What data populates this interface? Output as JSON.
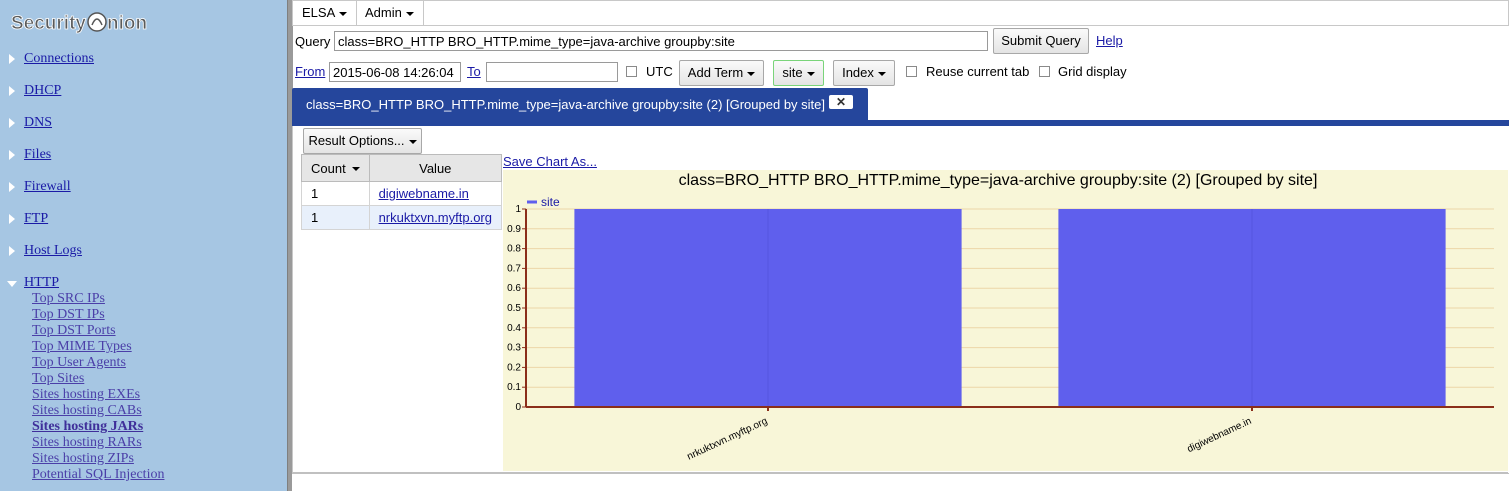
{
  "sidebar": {
    "logo_text": "SecurityOnion",
    "items": [
      {
        "label": "Connections"
      },
      {
        "label": "DHCP"
      },
      {
        "label": "DNS"
      },
      {
        "label": "Files"
      },
      {
        "label": "Firewall"
      },
      {
        "label": "FTP"
      },
      {
        "label": "Host Logs"
      },
      {
        "label": "HTTP"
      }
    ],
    "http_subitems": [
      {
        "label": "Top SRC IPs"
      },
      {
        "label": "Top DST IPs"
      },
      {
        "label": "Top DST Ports"
      },
      {
        "label": "Top MIME Types"
      },
      {
        "label": "Top User Agents"
      },
      {
        "label": "Top Sites"
      },
      {
        "label": "Sites hosting EXEs"
      },
      {
        "label": "Sites hosting CABs"
      },
      {
        "label": "Sites hosting JARs"
      },
      {
        "label": "Sites hosting RARs"
      },
      {
        "label": "Sites hosting ZIPs"
      },
      {
        "label": "Potential SQL Injection"
      }
    ]
  },
  "menubar": {
    "elsa": "ELSA",
    "admin": "Admin"
  },
  "query": {
    "label": "Query",
    "value": "class=BRO_HTTP BRO_HTTP.mime_type=java-archive groupby:site",
    "submit": "Submit Query",
    "help": "Help"
  },
  "options": {
    "from_label": "From",
    "from_value": "2015-06-08 14:26:04",
    "to_label": "To",
    "to_value": "",
    "utc_label": "UTC",
    "add_term": "Add Term",
    "groupby": "site",
    "index": "Index",
    "reuse_tab": "Reuse current tab",
    "grid_display": "Grid display"
  },
  "tab": {
    "label": "class=BRO_HTTP BRO_HTTP.mime_type=java-archive groupby:site (2) [Grouped by site]",
    "close": "✕"
  },
  "results": {
    "options_button": "Result Options...",
    "save_chart": "Save Chart As...",
    "columns": [
      "Count",
      "Value"
    ],
    "rows": [
      {
        "count": "1",
        "value": "digiwebname.in"
      },
      {
        "count": "1",
        "value": "nrkuktxvn.myftp.org"
      }
    ]
  },
  "chart_data": {
    "type": "bar",
    "title": "class=BRO_HTTP BRO_HTTP.mime_type=java-archive groupby:site (2) [Grouped by site]",
    "categories": [
      "nrkuktxvn.myftp.org",
      "digiwebname.in"
    ],
    "series": [
      {
        "name": "site",
        "values": [
          1,
          1
        ],
        "color": "#5f5fed"
      }
    ],
    "ylim": [
      0,
      1
    ],
    "yticks": [
      "0",
      "0.1",
      "0.2",
      "0.3",
      "0.4",
      "0.5",
      "0.6",
      "0.7",
      "0.8",
      "0.9",
      "1"
    ],
    "legend": "top-left",
    "grid": true,
    "background": "#f8f6d8",
    "axis_color": "#8b2e1a"
  }
}
